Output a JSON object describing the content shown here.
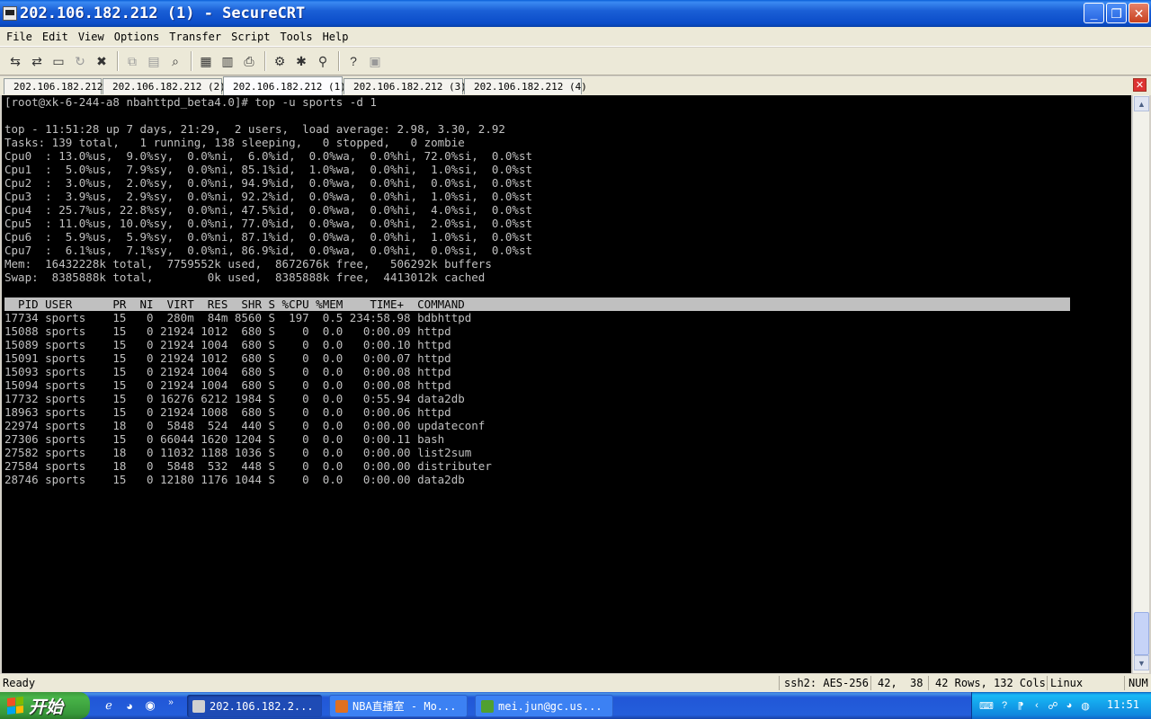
{
  "window": {
    "title": "202.106.182.212 (1) - SecureCRT"
  },
  "menu": [
    "File",
    "Edit",
    "View",
    "Options",
    "Transfer",
    "Script",
    "Tools",
    "Help"
  ],
  "toolbar_icons": [
    {
      "name": "connect-icon",
      "glyph": "⇆"
    },
    {
      "name": "quick-connect-icon",
      "glyph": "⇄"
    },
    {
      "name": "connect-tab-icon",
      "glyph": "▭"
    },
    {
      "name": "reconnect-icon",
      "glyph": "↻"
    },
    {
      "name": "disconnect-icon",
      "glyph": "✖"
    },
    {
      "name": "copy-icon",
      "glyph": "⧉"
    },
    {
      "name": "paste-icon",
      "glyph": "▤"
    },
    {
      "name": "find-icon",
      "glyph": "⌕"
    },
    {
      "name": "print-setup-icon",
      "glyph": "▦"
    },
    {
      "name": "print-selection-icon",
      "glyph": "▥"
    },
    {
      "name": "print-icon",
      "glyph": "⎙"
    },
    {
      "name": "session-options-icon",
      "glyph": "⚙"
    },
    {
      "name": "global-options-icon",
      "glyph": "✱"
    },
    {
      "name": "keymap-icon",
      "glyph": "⚲"
    },
    {
      "name": "help-icon",
      "glyph": "?"
    },
    {
      "name": "about-icon",
      "glyph": "▣"
    }
  ],
  "tabs": [
    {
      "label": "202.106.182.212",
      "color": "#3060c0",
      "active": false
    },
    {
      "label": "202.106.182.212 (2)",
      "color": "#3060c0",
      "active": false
    },
    {
      "label": "202.106.182.212 (1)",
      "color": "#30a040",
      "active": true
    },
    {
      "label": "202.106.182.212 (3)",
      "color": "#3060c0",
      "active": false
    },
    {
      "label": "202.106.182.212 (4)",
      "color": "#30a040",
      "active": false
    }
  ],
  "terminal": {
    "lines": [
      "[root@xk-6-244-a8 nbahttpd_beta4.0]# top -u sports -d 1",
      "",
      "top - 11:51:28 up 7 days, 21:29,  2 users,  load average: 2.98, 3.30, 2.92",
      "Tasks: 139 total,   1 running, 138 sleeping,   0 stopped,   0 zombie",
      "Cpu0  : 13.0%us,  9.0%sy,  0.0%ni,  6.0%id,  0.0%wa,  0.0%hi, 72.0%si,  0.0%st",
      "Cpu1  :  5.0%us,  7.9%sy,  0.0%ni, 85.1%id,  1.0%wa,  0.0%hi,  1.0%si,  0.0%st",
      "Cpu2  :  3.0%us,  2.0%sy,  0.0%ni, 94.9%id,  0.0%wa,  0.0%hi,  0.0%si,  0.0%st",
      "Cpu3  :  3.9%us,  2.9%sy,  0.0%ni, 92.2%id,  0.0%wa,  0.0%hi,  1.0%si,  0.0%st",
      "Cpu4  : 25.7%us, 22.8%sy,  0.0%ni, 47.5%id,  0.0%wa,  0.0%hi,  4.0%si,  0.0%st",
      "Cpu5  : 11.0%us, 10.0%sy,  0.0%ni, 77.0%id,  0.0%wa,  0.0%hi,  2.0%si,  0.0%st",
      "Cpu6  :  5.9%us,  5.9%sy,  0.0%ni, 87.1%id,  0.0%wa,  0.0%hi,  1.0%si,  0.0%st",
      "Cpu7  :  6.1%us,  7.1%sy,  0.0%ni, 86.9%id,  0.0%wa,  0.0%hi,  0.0%si,  0.0%st",
      "Mem:  16432228k total,  7759552k used,  8672676k free,   506292k buffers",
      "Swap:  8385888k total,        0k used,  8385888k free,  4413012k cached",
      "",
      "  PID USER      PR  NI  VIRT  RES  SHR S %CPU %MEM    TIME+  COMMAND",
      "17734 sports    15   0  280m  84m 8560 S  197  0.5 234:58.98 bdbhttpd",
      "15088 sports    15   0 21924 1012  680 S    0  0.0   0:00.09 httpd",
      "15089 sports    15   0 21924 1004  680 S    0  0.0   0:00.10 httpd",
      "15091 sports    15   0 21924 1012  680 S    0  0.0   0:00.07 httpd",
      "15093 sports    15   0 21924 1004  680 S    0  0.0   0:00.08 httpd",
      "15094 sports    15   0 21924 1004  680 S    0  0.0   0:00.08 httpd",
      "17732 sports    15   0 16276 6212 1984 S    0  0.0   0:55.94 data2db",
      "18963 sports    15   0 21924 1008  680 S    0  0.0   0:00.06 httpd",
      "22974 sports    18   0  5848  524  440 S    0  0.0   0:00.00 updateconf",
      "27306 sports    15   0 66044 1620 1204 S    0  0.0   0:00.11 bash",
      "27582 sports    18   0 11032 1188 1036 S    0  0.0   0:00.00 list2sum",
      "27584 sports    18   0  5848  532  448 S    0  0.0   0:00.00 distributer",
      "28746 sports    15   0 12180 1176 1044 S    0  0.0   0:00.00 data2db"
    ],
    "header_line_index": 15
  },
  "status": {
    "ready": "Ready",
    "cipher": "ssh2: AES-256",
    "cursor_row": "42,",
    "cursor_col": "38",
    "size": "42 Rows, 132 Cols",
    "os": "Linux",
    "num": "NUM"
  },
  "taskbar": {
    "start_label": "开始",
    "tasks": [
      {
        "label": "202.106.182.2...",
        "active": true,
        "icon_color": "#d0d0d0"
      },
      {
        "label": "NBA直播室 - Mo...",
        "active": false,
        "icon_color": "#e07020"
      },
      {
        "label": "mei.jun@gc.us...",
        "active": false,
        "icon_color": "#50a030"
      }
    ],
    "clock": "11:51"
  }
}
